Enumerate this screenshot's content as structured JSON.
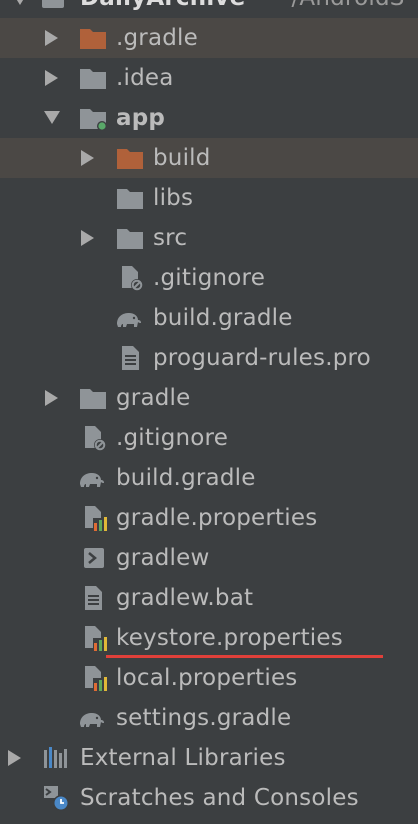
{
  "project": {
    "name": "DailyArchive",
    "path": "~/AndroidS"
  },
  "items": [
    {
      "label": ".gradle",
      "icon": "folder-orange-icon",
      "arrow": "right"
    },
    {
      "label": ".idea",
      "icon": "folder-icon",
      "arrow": "right"
    },
    {
      "label": "app",
      "icon": "module-folder-icon",
      "arrow": "down"
    },
    {
      "label": "build",
      "icon": "folder-orange-icon",
      "arrow": "right"
    },
    {
      "label": "libs",
      "icon": "folder-icon"
    },
    {
      "label": "src",
      "icon": "folder-icon",
      "arrow": "right"
    },
    {
      "label": ".gitignore",
      "icon": "ignored-file-icon"
    },
    {
      "label": "build.gradle",
      "icon": "gradle-elephant-icon"
    },
    {
      "label": "proguard-rules.pro",
      "icon": "text-file-icon"
    },
    {
      "label": "gradle",
      "icon": "folder-icon",
      "arrow": "right"
    },
    {
      "label": ".gitignore",
      "icon": "ignored-file-icon"
    },
    {
      "label": "build.gradle",
      "icon": "gradle-elephant-icon"
    },
    {
      "label": "gradle.properties",
      "icon": "properties-file-icon"
    },
    {
      "label": "gradlew",
      "icon": "shell-script-icon"
    },
    {
      "label": "gradlew.bat",
      "icon": "text-file-icon"
    },
    {
      "label": "keystore.properties",
      "icon": "properties-file-icon"
    },
    {
      "label": "local.properties",
      "icon": "properties-file-icon"
    },
    {
      "label": "settings.gradle",
      "icon": "gradle-elephant-icon"
    },
    {
      "label": "External Libraries",
      "icon": "libraries-icon",
      "arrow": "right"
    },
    {
      "label": "Scratches and Consoles",
      "icon": "scratches-icon"
    }
  ],
  "colors": {
    "background": "#3c3f41",
    "highlight": "#4b4845",
    "text": "#bbbbbb",
    "folder": "#8f9498",
    "folder_orange": "#b0613a",
    "underline": "#e0403a"
  }
}
